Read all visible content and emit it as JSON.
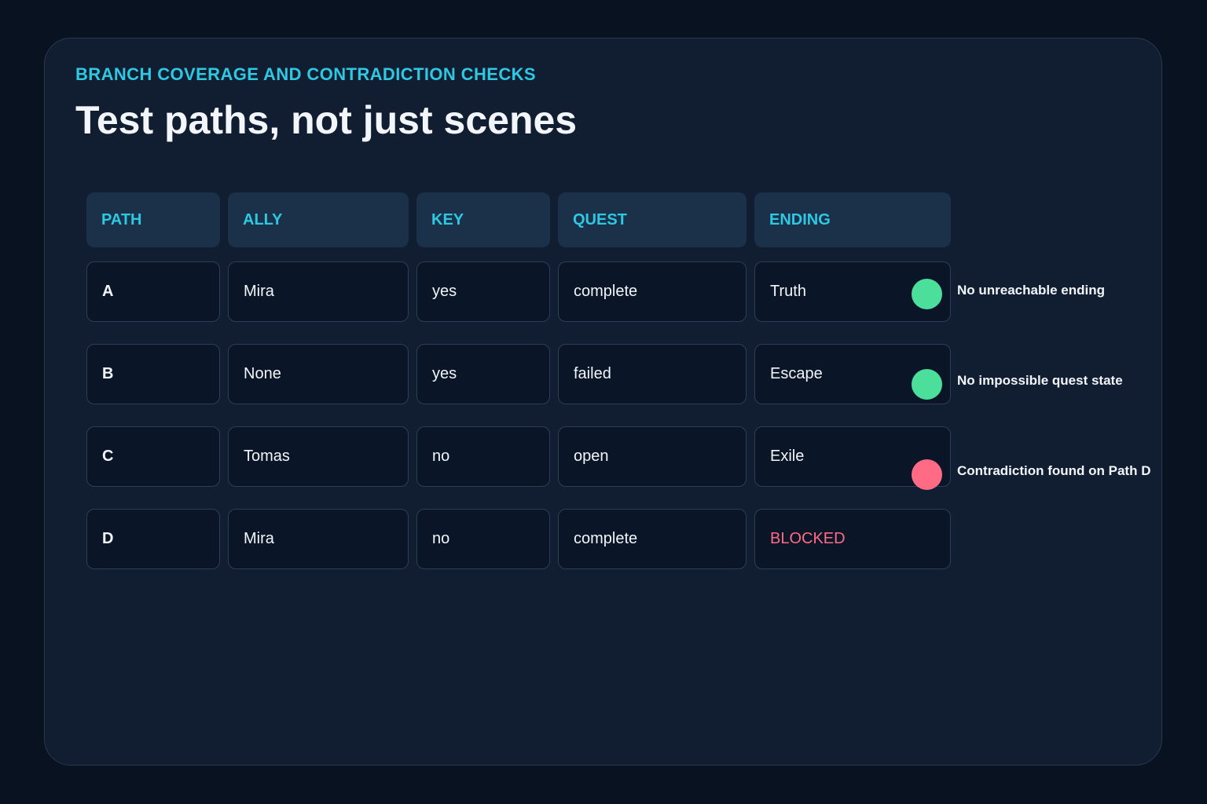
{
  "header": {
    "eyebrow": "BRANCH COVERAGE AND CONTRADICTION CHECKS",
    "title": "Test paths, not just scenes"
  },
  "table": {
    "columns": [
      "PATH",
      "ALLY",
      "KEY",
      "QUEST",
      "ENDING"
    ],
    "rows": [
      {
        "path": "A",
        "ally": "Mira",
        "key": "yes",
        "quest": "complete",
        "ending": "Truth"
      },
      {
        "path": "B",
        "ally": "None",
        "key": "yes",
        "quest": "failed",
        "ending": "Escape"
      },
      {
        "path": "C",
        "ally": "Tomas",
        "key": "no",
        "quest": "open",
        "ending": "Exile"
      },
      {
        "path": "D",
        "ally": "Mira",
        "key": "no",
        "quest": "complete",
        "ending": "BLOCKED"
      }
    ]
  },
  "checks": [
    {
      "label": "No unreachable ending",
      "status": "pass",
      "color": "#4cdf9b"
    },
    {
      "label": "No impossible quest state",
      "status": "pass",
      "color": "#4cdf9b"
    },
    {
      "label": "Contradiction found on Path D",
      "status": "fail",
      "color": "#ff6b84"
    }
  ],
  "colors": {
    "accent": "#2ec8e2",
    "pass": "#4cdf9b",
    "fail": "#ff6b84",
    "card": "#111e31",
    "background": "#091221"
  }
}
